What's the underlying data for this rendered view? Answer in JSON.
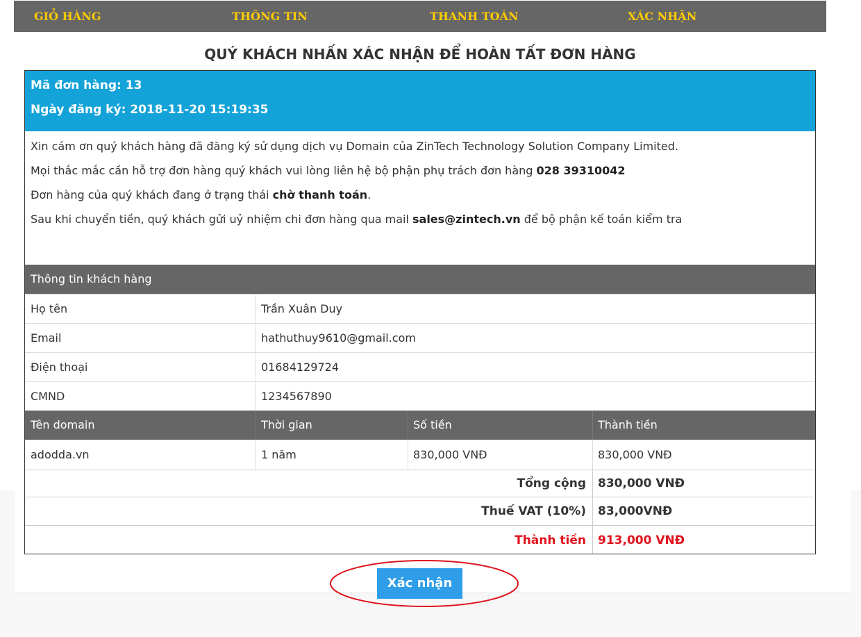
{
  "steps": [
    "GIỎ HÀNG",
    "THÔNG TIN",
    "THANH TOÁN",
    "XÁC NHẬN"
  ],
  "title": "QUÝ KHÁCH NHẤN XÁC NHẬN ĐỂ HOÀN TẤT ĐƠN HÀNG",
  "order": {
    "code_line": "Mã đơn hàng: 13",
    "date_line": "Ngày đăng ký: 2018-11-20 15:19:35"
  },
  "messages": {
    "thanks": "Xin cám ơn quý khách hàng đã đăng ký sử dụng dịch vụ Domain của ZinTech Technology Solution Company Limited.",
    "support_prefix": "Mọi thắc mắc cần hỗ trợ đơn hàng quý khách vui lòng liên hệ bộ phận phụ trách đơn hàng ",
    "support_phone": "028 39310042",
    "status_prefix": "Đơn hàng của quý khách đang ở trạng thái ",
    "status_value": "chờ thanh toán",
    "status_suffix": ".",
    "transfer_prefix": "Sau khi chuyển tiền, quý khách gửi uỷ nhiệm chi đơn hàng qua mail ",
    "transfer_email": "sales@zintech.vn",
    "transfer_suffix": " để bộ phận kế toán kiểm tra"
  },
  "customer": {
    "header": "Thông tin khách hàng",
    "rows": [
      {
        "label": "Họ tên",
        "value": "Trần Xuân Duy"
      },
      {
        "label": "Email",
        "value": "hathuthuy9610@gmail.com"
      },
      {
        "label": "Điện thoại",
        "value": "01684129724"
      },
      {
        "label": "CMND",
        "value": "1234567890"
      }
    ]
  },
  "domain_table": {
    "headers": [
      "Tên domain",
      "Thời gian",
      "Số tiền",
      "Thành tiền"
    ],
    "rows": [
      [
        "adodda.vn",
        "1 năm",
        "830,000 VNĐ",
        "830,000 VNĐ"
      ]
    ]
  },
  "totals": {
    "subtotal_label": "Tổng cộng",
    "subtotal_value": "830,000 VNĐ",
    "vat_label": "Thuế VAT (10%)",
    "vat_value": "83,000VNĐ",
    "grand_label": "Thành tiền",
    "grand_value": "913,000 VNĐ"
  },
  "confirm_button": "Xác nhận",
  "colors": {
    "step_bar": "#666666",
    "step_text": "#ffcc00",
    "order_header": "#14a3d9",
    "button": "#2f9de8",
    "grand_total": "#e0121b",
    "highlight_ellipse": "#e0121b"
  }
}
